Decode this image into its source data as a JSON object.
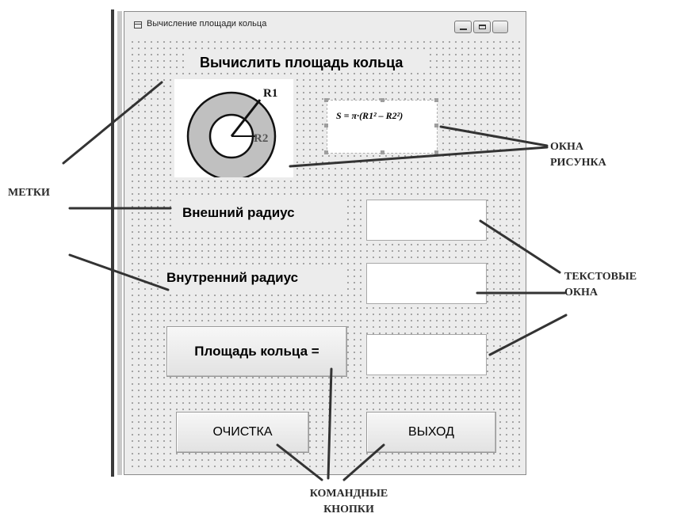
{
  "window": {
    "title": "Вычисление площади кольца"
  },
  "form": {
    "heading": "Вычислить площадь кольца",
    "outer_radius_label": "Внешний радиус",
    "inner_radius_label": "Внутренний радиус",
    "area_button": "Площадь кольца =",
    "clear_button": "ОЧИСТКА",
    "exit_button": "ВЫХОД",
    "outer_radius_value": "",
    "inner_radius_value": "",
    "area_value": ""
  },
  "picture": {
    "r1_label": "R1",
    "r2_label": "R2",
    "formula": "S = π·(R1² – R2²)"
  },
  "annotations": {
    "labels": "МЕТКИ",
    "picture_boxes_line1": "ОКНА",
    "picture_boxes_line2": "РИСУНКА",
    "text_boxes_line1": "ТЕКСТОВЫЕ",
    "text_boxes_line2": "ОКНА",
    "command_buttons_line1": "КОМАНДНЫЕ",
    "command_buttons_line2": "КНОПКИ"
  },
  "colors": {
    "ring_fill": "#c0c0c0",
    "form_background": "#ececec",
    "annotation_line": "#333333"
  }
}
